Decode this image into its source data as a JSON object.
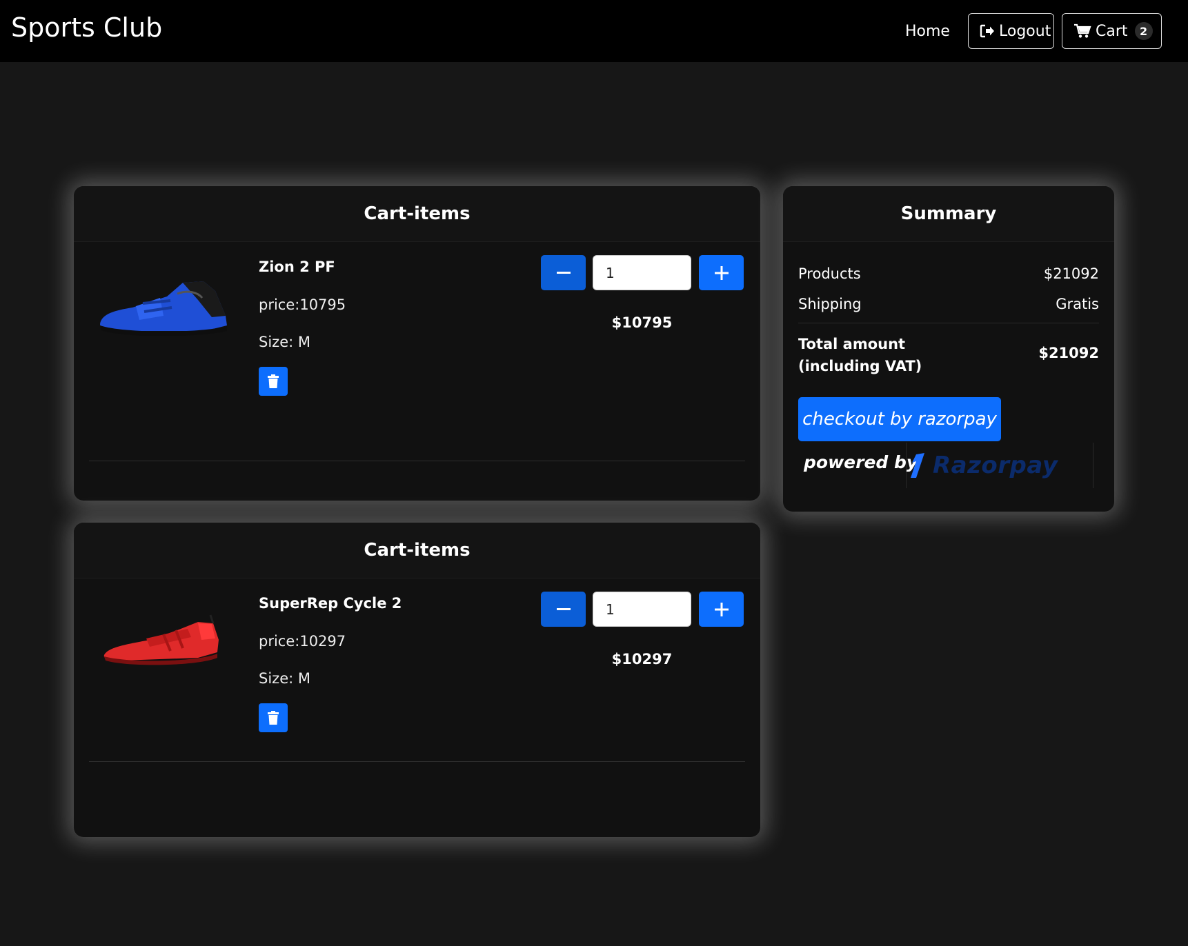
{
  "navbar": {
    "brand": "Sports Club",
    "home_label": "Home",
    "logout_label": "Logout",
    "cart_label": "Cart",
    "cart_count": "2"
  },
  "cart_items": [
    {
      "header": "Cart-items",
      "name": "Zion 2 PF",
      "price_text": "price:10795",
      "size_text": "Size: M",
      "quantity": "1",
      "line_total": "$10795",
      "image_color": "blue"
    },
    {
      "header": "Cart-items",
      "name": "SuperRep Cycle 2",
      "price_text": "price:10297",
      "size_text": "Size: M",
      "quantity": "1",
      "line_total": "$10297",
      "image_color": "red"
    }
  ],
  "summary": {
    "title": "Summary",
    "products_label": "Products",
    "products_value": "$21092",
    "shipping_label": "Shipping",
    "shipping_value": "Gratis",
    "total_label_line1": "Total amount",
    "total_label_line2": "(including VAT)",
    "total_value": "$21092",
    "checkout_label": "checkout by razorpay",
    "powered_by_label": "powered by",
    "razorpay_logo_text": "Razorpay"
  },
  "colors": {
    "primary": "#0d6efd",
    "background": "#171717",
    "navbar": "#000000"
  }
}
